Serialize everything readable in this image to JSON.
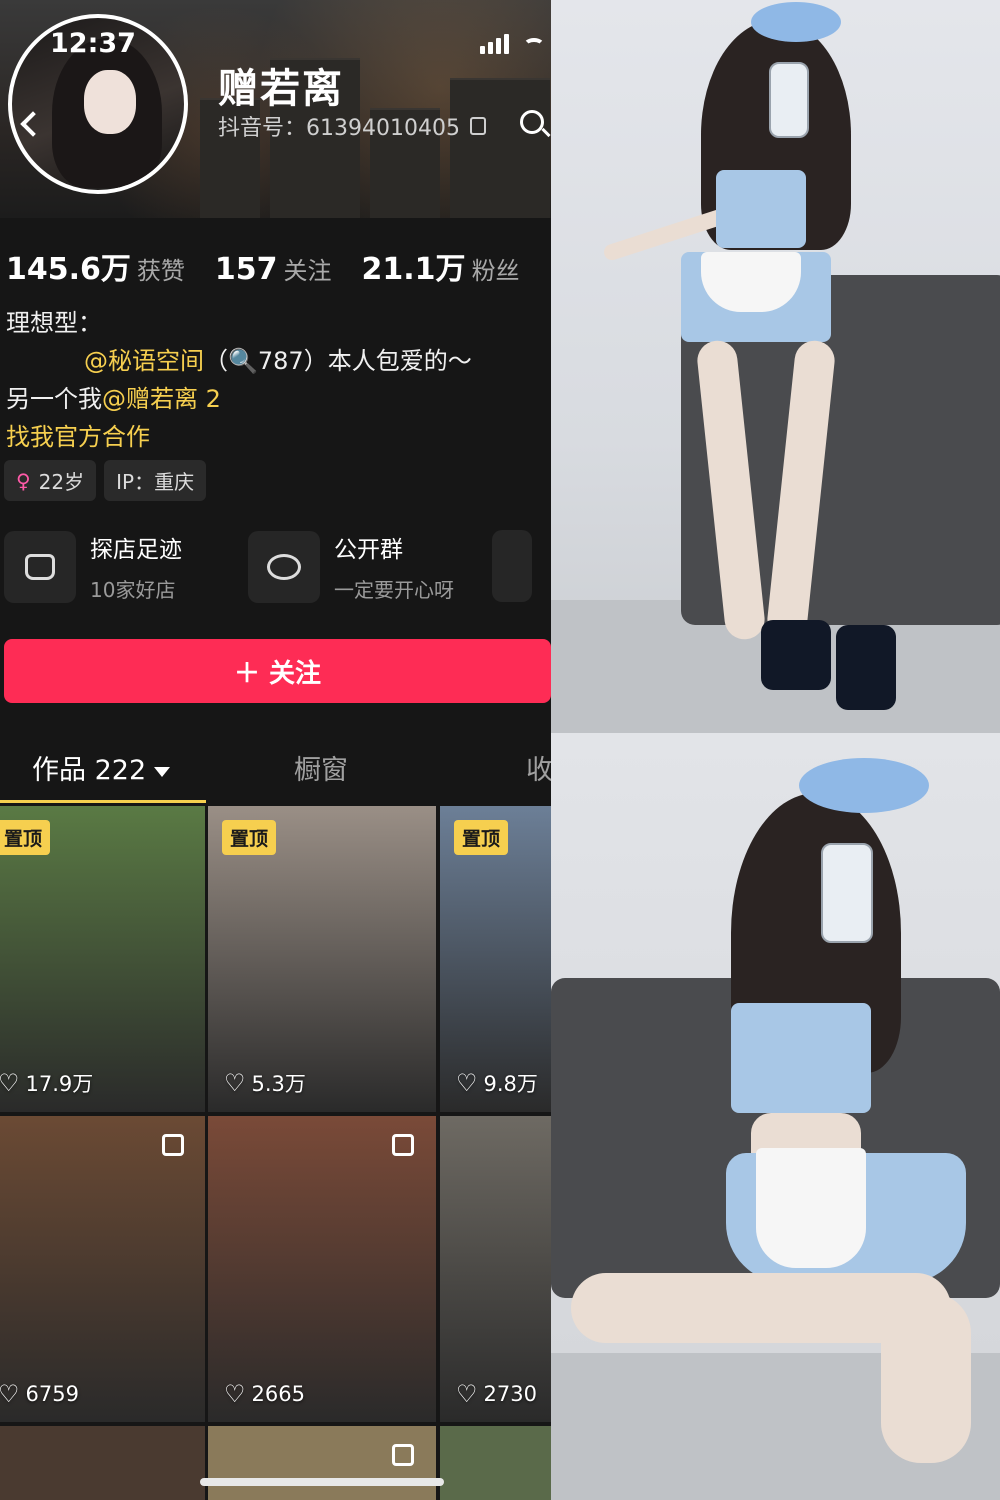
{
  "status": {
    "time": "12:37"
  },
  "profile": {
    "nickname": "赠若离",
    "douyin_id": "抖音号：61394010405"
  },
  "stats": [
    {
      "num": "145.6万",
      "label": "获赞"
    },
    {
      "num": "157",
      "label": "关注"
    },
    {
      "num": "21.1万",
      "label": "粉丝"
    }
  ],
  "bio": {
    "line1": "理想型：",
    "line2_mention": "@秘语空间",
    "line2_rest": "（🔍787）本人包爱的～",
    "line3_prefix": "另一个我",
    "line3_mention": "@赠若离 2",
    "line4": "找我官方合作"
  },
  "tags": {
    "age": "22岁",
    "ip": "IP：重庆"
  },
  "services": [
    {
      "title": "探店足迹",
      "sub": "10家好店",
      "icon": "shop-icon"
    },
    {
      "title": "公开群",
      "sub": "一定要开心呀",
      "icon": "group-chat-icon"
    }
  ],
  "follow_label": "＋ 关注",
  "tabs": {
    "works": "作品 222",
    "window": "橱窗",
    "collect": "收"
  },
  "videos": [
    {
      "pinned": "置顶",
      "likes": "17.9万",
      "bg": "#5a7a44"
    },
    {
      "pinned": "置顶",
      "likes": "5.3万",
      "bg": "#9a8f86"
    },
    {
      "pinned": "置顶",
      "likes": "9.8万",
      "bg": "#6c7f97"
    },
    {
      "pinned": "",
      "likes": "6759",
      "bg": "#6b4a34"
    },
    {
      "pinned": "",
      "likes": "2665",
      "bg": "#7a4a38"
    },
    {
      "pinned": "",
      "likes": "2730",
      "bg": "#6e6a63"
    }
  ],
  "colors": {
    "accent": "#fe2c55",
    "gold": "#f6cf4f",
    "bg": "#161616"
  }
}
